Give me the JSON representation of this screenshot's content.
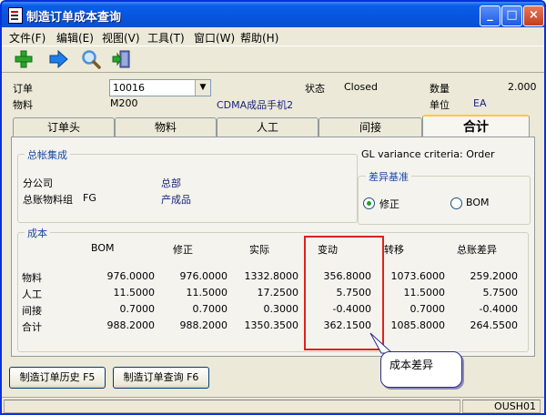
{
  "window": {
    "title": "制造订单成本查询",
    "minimize": "_",
    "maximize": "□",
    "close": "×"
  },
  "menu": [
    "文件(F)",
    "编辑(E)",
    "视图(V)",
    "工具(T)",
    "窗口(W)",
    "帮助(H)"
  ],
  "toolbar": {
    "icons": [
      "add-icon",
      "arrow-right-icon",
      "magnifier-icon",
      "exit-door-icon"
    ],
    "colors": {
      "add": "#2aa52a",
      "arrow": "#1e7ee8",
      "magnifier": "#4a90d9"
    }
  },
  "header": {
    "order_label": "订单",
    "order_value": "10016",
    "material_label": "物料",
    "material_code": "M200",
    "material_desc": "CDMA成品手机2",
    "status_label": "状态",
    "status_value": "Closed",
    "qty_label": "数量",
    "qty_value": "2.000",
    "unit_label": "单位",
    "unit_value": "EA"
  },
  "tabs": [
    "订单头",
    "物料",
    "人工",
    "间接",
    "合计"
  ],
  "active_tab": "合计",
  "ledger": {
    "title": "总帐集成",
    "company_label": "分公司",
    "company_value": "总部",
    "group_label": "总账物料组",
    "group_code": "FG",
    "group_value": "产成品"
  },
  "variance": {
    "criteria": "GL variance criteria: Order",
    "basis_title": "差异基准",
    "option_revised": "修正",
    "option_bom": "BOM",
    "selected": "修正"
  },
  "cost": {
    "title": "成本",
    "columns": [
      "BOM",
      "修正",
      "实际",
      "变动",
      "转移",
      "总账差异"
    ],
    "rows": [
      {
        "label": "物料",
        "values": [
          "976.0000",
          "976.0000",
          "1332.8000",
          "356.8000",
          "1073.6000",
          "259.2000"
        ]
      },
      {
        "label": "人工",
        "values": [
          "11.5000",
          "11.5000",
          "17.2500",
          "5.7500",
          "11.5000",
          "5.7500"
        ]
      },
      {
        "label": "间接",
        "values": [
          "0.7000",
          "0.7000",
          "0.3000",
          "-0.4000",
          "0.7000",
          "-0.4000"
        ]
      },
      {
        "label": "合计",
        "values": [
          "988.2000",
          "988.2000",
          "1350.3500",
          "362.1500",
          "1085.8000",
          "264.5500"
        ]
      }
    ]
  },
  "buttons": {
    "history": "制造订单历史 F5",
    "query": "制造订单查询 F6"
  },
  "annotation": {
    "callout": "成本差异",
    "highlight_color": "#e02020"
  },
  "status": {
    "user": "OUSH01"
  }
}
